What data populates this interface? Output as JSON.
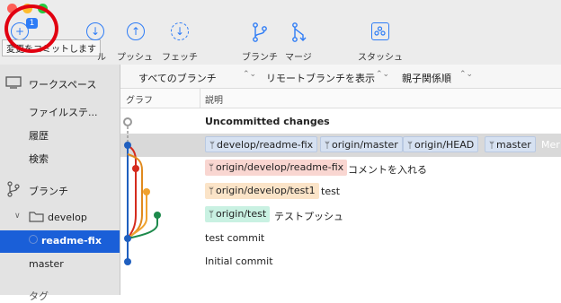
{
  "toolbar": {
    "commit_badge": "1",
    "commit_tooltip": "変更をコミットします",
    "pull_label": "ル",
    "push_label": "プッシュ",
    "fetch_label": "フェッチ",
    "branch_label": "ブランチ",
    "merge_label": "マージ",
    "stash_label": "スタッシュ"
  },
  "sidebar": {
    "workspace": "ワークスペース",
    "file_status": "ファイルステ...",
    "history": "履歴",
    "search": "検索",
    "branches": "ブランチ",
    "develop_folder": "develop",
    "readme_fix": "readme-fix",
    "master": "master",
    "tags_partial": "タグ"
  },
  "filters": {
    "branch_filter": "すべてのブランチ",
    "remote_display": "リモートブランチを表示",
    "sort_order": "親子関係順"
  },
  "columns": {
    "graph": "グラフ",
    "description": "説明"
  },
  "commits": [
    {
      "message": "Uncommitted changes"
    },
    {
      "refs": [
        "develop/readme-fix",
        "origin/master",
        "origin/HEAD",
        "master"
      ],
      "message": "Mer"
    },
    {
      "refs": [
        "origin/develop/readme-fix"
      ],
      "message": "コメントを入れる"
    },
    {
      "refs": [
        "origin/develop/test1"
      ],
      "message": "test"
    },
    {
      "refs": [
        "origin/test"
      ],
      "message": "テストプッシュ"
    },
    {
      "message": "test commit"
    },
    {
      "message": "Initial commit"
    }
  ],
  "colors": {
    "accent": "#2e7cf6",
    "selection": "#1a5fd8",
    "graph_blue": "#1f5fbf",
    "graph_red": "#d52b1e",
    "graph_orange": "#f0a22e",
    "graph_green": "#1e8a4c",
    "annotation_red": "#e10010"
  },
  "icons": [
    "commit-icon",
    "pull-icon",
    "push-icon",
    "fetch-icon",
    "branch-icon",
    "merge-icon",
    "stash-icon",
    "monitor-icon",
    "folder-icon",
    "branch-glyph-icon"
  ]
}
